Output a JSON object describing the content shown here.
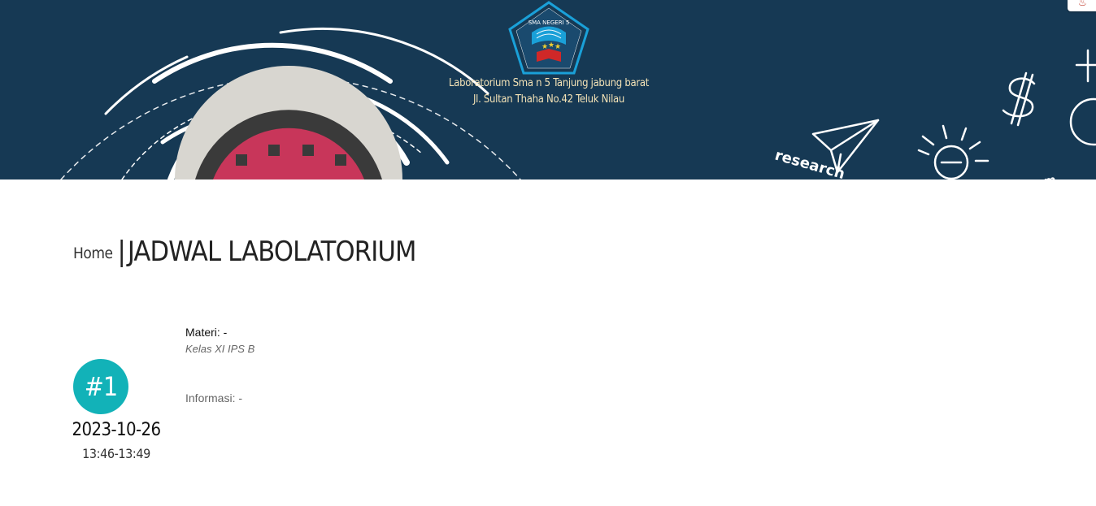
{
  "header": {
    "school_name": "Laboratorium Sma n 5 Tanjung jabung barat",
    "school_address": "Jl. Sultan Thaha No.42 Teluk Nilau",
    "logo_icon": "school-crest-icon",
    "banner_word": "research",
    "colors": {
      "background": "#163954",
      "header_text": "#f3e2b6",
      "accent": "#12b2b8",
      "gear": "#c8365a"
    }
  },
  "breadcrumb": {
    "home_label": "Home",
    "separator": "|",
    "page_title": "JADWAL LABOLATORIUM"
  },
  "schedule": {
    "entries": [
      {
        "number": "#1",
        "date": "2023-10-26",
        "time": "13:46-13:49",
        "materi": "Materi: -",
        "kelas": "Kelas XI IPS B",
        "informasi": "Informasi: -"
      }
    ]
  }
}
